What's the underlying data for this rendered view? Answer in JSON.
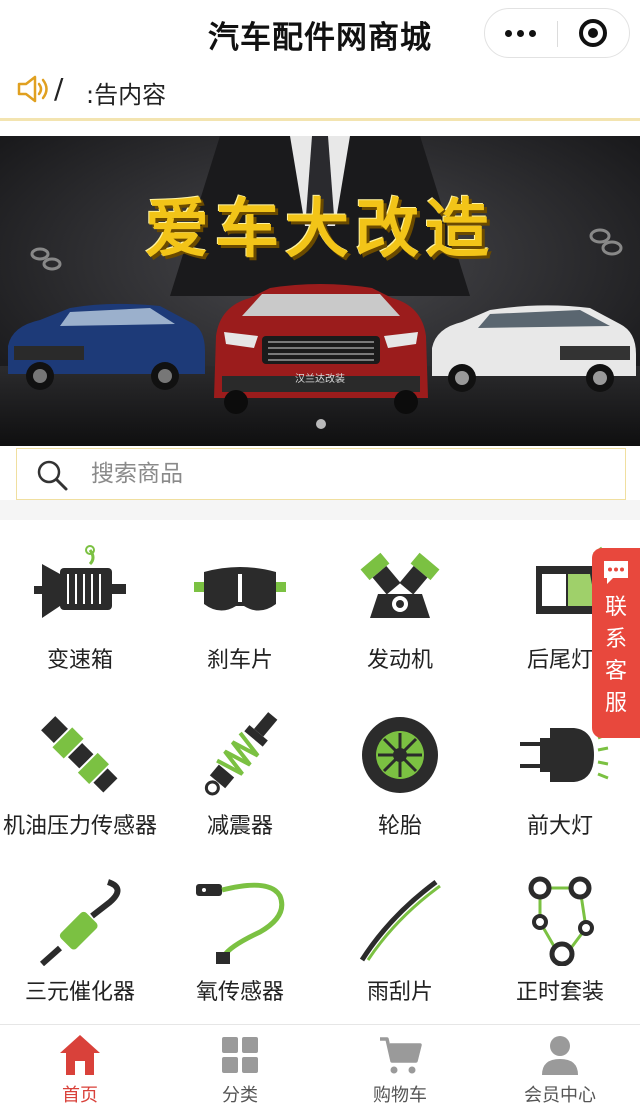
{
  "app": {
    "title": "汽车配件网商城"
  },
  "notice": {
    "slash": "/",
    "text": ":告内容"
  },
  "banner": {
    "slogan": "爱车大改造",
    "plate": "汉兰达改装",
    "slide_index": 1,
    "slide_count": 1
  },
  "search": {
    "placeholder": "搜索商品"
  },
  "categories": [
    {
      "label": "变速箱",
      "icon": "gearbox-icon"
    },
    {
      "label": "刹车片",
      "icon": "brake-pad-icon"
    },
    {
      "label": "发动机",
      "icon": "engine-icon"
    },
    {
      "label": "后尾灯",
      "icon": "tail-light-icon"
    },
    {
      "label": "机油压力传感器",
      "icon": "oil-pressure-sensor-icon"
    },
    {
      "label": "减震器",
      "icon": "shock-absorber-icon"
    },
    {
      "label": "轮胎",
      "icon": "tire-icon"
    },
    {
      "label": "前大灯",
      "icon": "headlight-icon"
    },
    {
      "label": "三元催化器",
      "icon": "catalytic-converter-icon"
    },
    {
      "label": "氧传感器",
      "icon": "oxygen-sensor-icon"
    },
    {
      "label": "雨刮片",
      "icon": "wiper-blade-icon"
    },
    {
      "label": "正时套装",
      "icon": "timing-kit-icon"
    }
  ],
  "service": {
    "label": "联系客服"
  },
  "tabs": [
    {
      "label": "首页",
      "icon": "home-icon",
      "active": true
    },
    {
      "label": "分类",
      "icon": "grid-icon",
      "active": false
    },
    {
      "label": "购物车",
      "icon": "cart-icon",
      "active": false
    },
    {
      "label": "会员中心",
      "icon": "user-icon",
      "active": false
    }
  ],
  "colors": {
    "accent": "#d9413a",
    "icon_green": "#7bc142",
    "icon_dark": "#2b2b2b",
    "banner_text": "#f2c418"
  }
}
